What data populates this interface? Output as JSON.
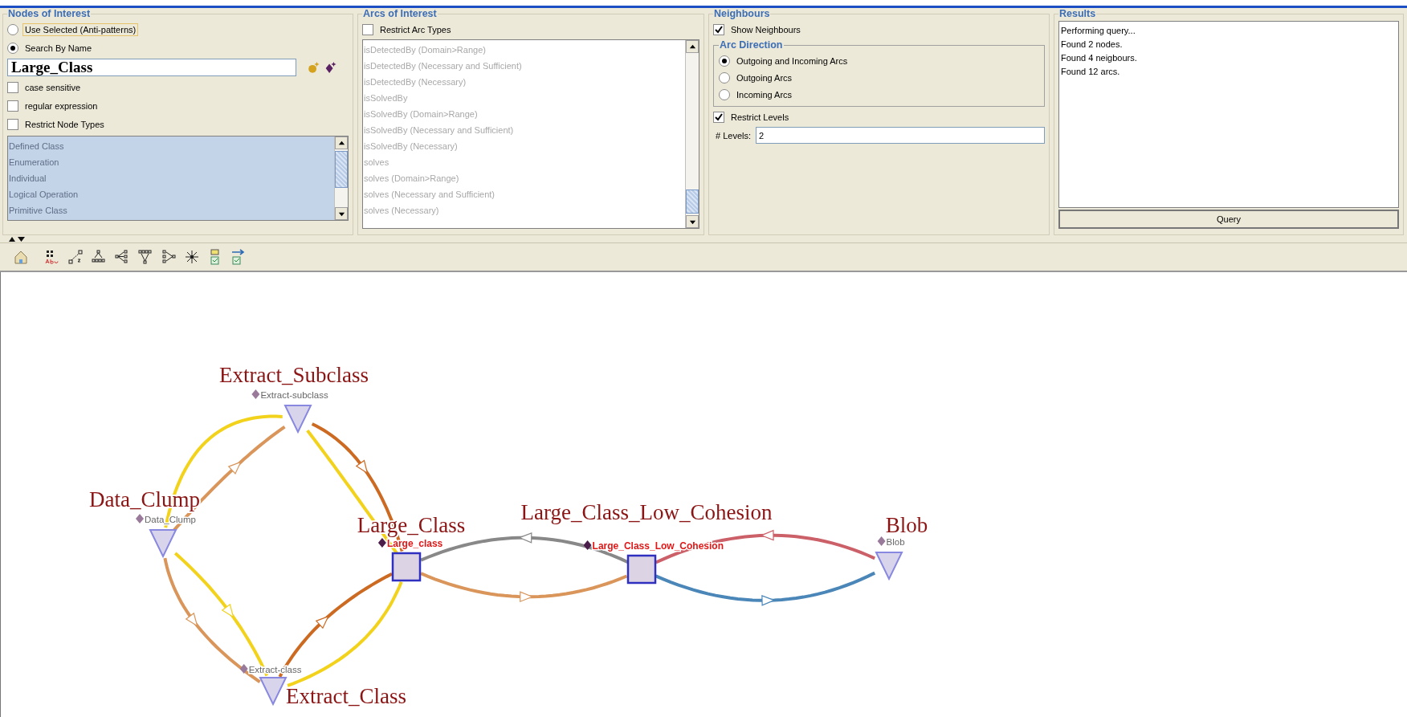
{
  "nodes_of_interest": {
    "title": "Nodes of Interest",
    "modes": [
      {
        "label": "Use Selected (Anti-patterns)",
        "selected": false,
        "focused": true
      },
      {
        "label": "Search By Name",
        "selected": true,
        "focused": false
      }
    ],
    "search": {
      "value": "Large_Class"
    },
    "options": [
      {
        "label": "case sensitive",
        "checked": false
      },
      {
        "label": "regular expression",
        "checked": false
      },
      {
        "label": "Restrict Node Types",
        "checked": false
      }
    ],
    "node_types": [
      "Defined Class",
      "Enumeration",
      "Individual",
      "Logical Operation",
      "Primitive Class"
    ]
  },
  "arcs_of_interest": {
    "title": "Arcs of Interest",
    "restrict": {
      "label": "Restrict Arc Types",
      "checked": false
    },
    "arc_types": [
      "isDetectedBy (Domain>Range)",
      "isDetectedBy (Necessary and Sufficient)",
      "isDetectedBy (Necessary)",
      "isSolvedBy",
      "isSolvedBy (Domain>Range)",
      "isSolvedBy (Necessary and Sufficient)",
      "isSolvedBy (Necessary)",
      "solves",
      "solves (Domain>Range)",
      "solves (Necessary and Sufficient)",
      "solves (Necessary)"
    ]
  },
  "neighbours": {
    "title": "Neighbours",
    "show": {
      "label": "Show Neighbours",
      "checked": true
    },
    "arc_direction": {
      "title": "Arc Direction",
      "options": [
        {
          "label": "Outgoing and Incoming Arcs",
          "selected": true
        },
        {
          "label": "Outgoing Arcs",
          "selected": false
        },
        {
          "label": "Incoming Arcs",
          "selected": false
        }
      ]
    },
    "restrict_levels": {
      "label": "Restrict Levels",
      "checked": true
    },
    "levels": {
      "label": "# Levels:",
      "value": "2"
    }
  },
  "results": {
    "title": "Results",
    "lines": [
      "Performing query...",
      "Found 2 nodes.",
      "Found 4 neigbours.",
      "Found 12 arcs."
    ],
    "button": "Query"
  },
  "graph": {
    "nodes": [
      {
        "label": "Extract_Subclass",
        "sublabel": "Extract-subclass",
        "kind": "neighbour"
      },
      {
        "label": "Data_Clump",
        "sublabel": "Data_Clump",
        "kind": "neighbour"
      },
      {
        "label": "Large_Class",
        "sublabel": "Large_class",
        "kind": "match"
      },
      {
        "label": "Large_Class_Low_Cohesion",
        "sublabel": "Large_Class_Low_Cohesion",
        "kind": "match"
      },
      {
        "label": "Blob",
        "sublabel": "Blob",
        "kind": "neighbour"
      },
      {
        "label": "Extract_Class",
        "sublabel": "Extract-class",
        "kind": "neighbour"
      }
    ]
  }
}
